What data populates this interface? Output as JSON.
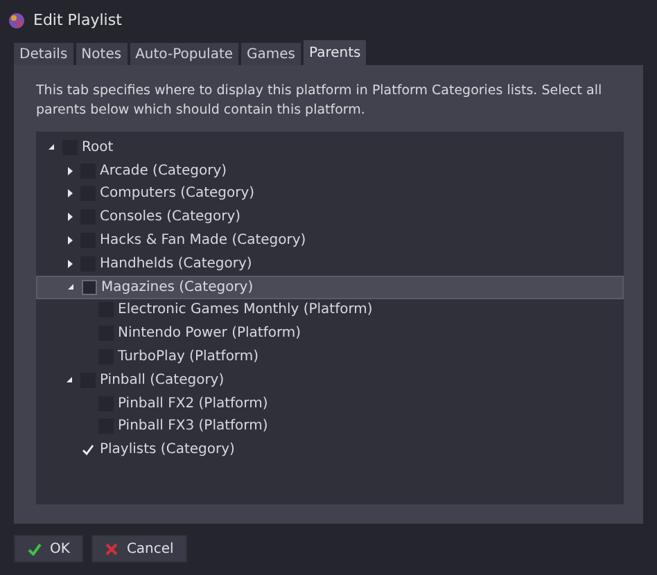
{
  "window": {
    "title": "Edit Playlist"
  },
  "tabs": [
    {
      "label": "Details",
      "selected": false
    },
    {
      "label": "Notes",
      "selected": false
    },
    {
      "label": "Auto-Populate",
      "selected": false
    },
    {
      "label": "Games",
      "selected": false
    },
    {
      "label": "Parents",
      "selected": true
    }
  ],
  "description": "This tab specifies where to display this platform in Platform Categories lists. Select all parents below which should contain this platform.",
  "tree": [
    {
      "label": "Root",
      "checked": false,
      "selected": false,
      "expanded": true,
      "children": [
        {
          "label": "Arcade (Category)",
          "checked": false,
          "selected": false,
          "expanded": false
        },
        {
          "label": "Computers (Category)",
          "checked": false,
          "selected": false,
          "expanded": false
        },
        {
          "label": "Consoles (Category)",
          "checked": false,
          "selected": false,
          "expanded": false
        },
        {
          "label": "Hacks & Fan Made (Category)",
          "checked": false,
          "selected": false,
          "expanded": false
        },
        {
          "label": "Handhelds (Category)",
          "checked": false,
          "selected": false,
          "expanded": false
        },
        {
          "label": "Magazines (Category)",
          "checked": false,
          "selected": true,
          "expanded": true,
          "children": [
            {
              "label": "Electronic Games Monthly (Platform)",
              "checked": false,
              "selected": false
            },
            {
              "label": "Nintendo Power (Platform)",
              "checked": false,
              "selected": false
            },
            {
              "label": "TurboPlay (Platform)",
              "checked": false,
              "selected": false
            }
          ]
        },
        {
          "label": "Pinball (Category)",
          "checked": false,
          "selected": false,
          "expanded": true,
          "children": [
            {
              "label": "Pinball FX2 (Platform)",
              "checked": false,
              "selected": false
            },
            {
              "label": "Pinball FX3 (Platform)",
              "checked": false,
              "selected": false
            }
          ]
        },
        {
          "label": "Playlists (Category)",
          "checked": true,
          "selected": false
        }
      ]
    }
  ],
  "buttons": [
    {
      "kind": "ok",
      "label": "OK"
    },
    {
      "kind": "cancel",
      "label": "Cancel"
    }
  ]
}
